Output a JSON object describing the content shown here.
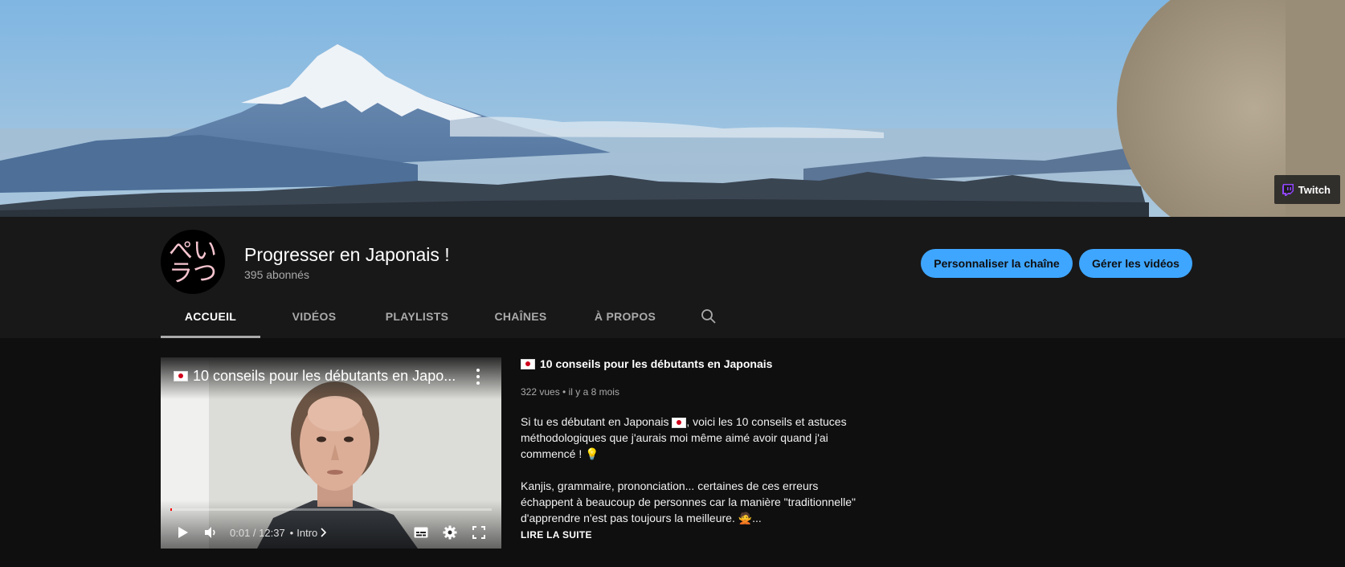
{
  "banner": {
    "link_label": "Twitch",
    "link_icon": "twitch-icon"
  },
  "channel": {
    "name": "Progresser en Japonais !",
    "subscribers": "395 abonnés",
    "avatar_text": [
      "ぺ",
      "い",
      "ラ",
      "つ"
    ],
    "buttons": {
      "customize": "Personnaliser la chaîne",
      "manage": "Gérer les vidéos"
    },
    "tabs": [
      {
        "label": "ACCUEIL",
        "active": true
      },
      {
        "label": "VIDÉOS",
        "active": false
      },
      {
        "label": "PLAYLISTS",
        "active": false
      },
      {
        "label": "CHAÎNES",
        "active": false
      },
      {
        "label": "À PROPOS",
        "active": false
      }
    ]
  },
  "player": {
    "title": "10 conseils pour les débutants en Japo...",
    "current_time": "0:01 / 12:37",
    "chapter": "Intro",
    "progress": 0.0013
  },
  "video_info": {
    "title": "10 conseils pour les débutants en Japonais",
    "views": "322 vues",
    "age": "il y a 8 mois",
    "description_p1a": "Si tu es débutant en Japonais ",
    "description_p1b": ", voici les 10 conseils et astuces méthodologiques que j'aurais moi même aimé avoir quand j'ai commencé ! 💡",
    "description_p2": "Kanjis, grammaire, prononciation... certaines de ces erreurs échappent à beaucoup de personnes car la manière \"traditionnelle\" d'apprendre n'est pas toujours la meilleure. 🙅...",
    "read_more": "LIRE LA SUITE"
  },
  "colors": {
    "accent": "#3ea6ff",
    "background": "#181818",
    "content_background": "#0f0f0f"
  }
}
